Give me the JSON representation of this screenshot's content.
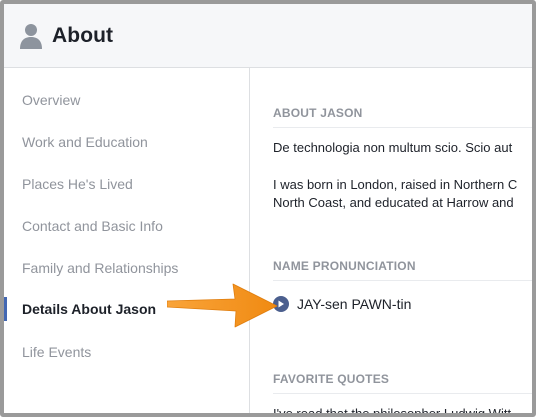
{
  "header": {
    "title": "About",
    "icon": "person-icon"
  },
  "sidebar": {
    "items": [
      {
        "label": "Overview",
        "active": false
      },
      {
        "label": "Work and Education",
        "active": false
      },
      {
        "label": "Places He's Lived",
        "active": false
      },
      {
        "label": "Contact and Basic Info",
        "active": false
      },
      {
        "label": "Family and Relationships",
        "active": false
      },
      {
        "label": "Details About Jason",
        "active": true
      },
      {
        "label": "Life Events",
        "active": false
      }
    ]
  },
  "main": {
    "about": {
      "heading": "ABOUT JASON",
      "line1": "De technologia non multum scio. Scio aut",
      "line2": "I was born in London, raised in Northern C",
      "line3": "North Coast, and educated at Harrow and"
    },
    "pronunciation": {
      "heading": "NAME PRONUNCIATION",
      "text": "JAY-sen PAWN-tin",
      "icon": "play-icon"
    },
    "quotes": {
      "heading": "FAVORITE QUOTES",
      "line1": "I've read that the philosopher Ludwig Witt"
    }
  },
  "colors": {
    "accent": "#4267b2",
    "arrow": "#f7941d",
    "muted": "#90949c"
  }
}
